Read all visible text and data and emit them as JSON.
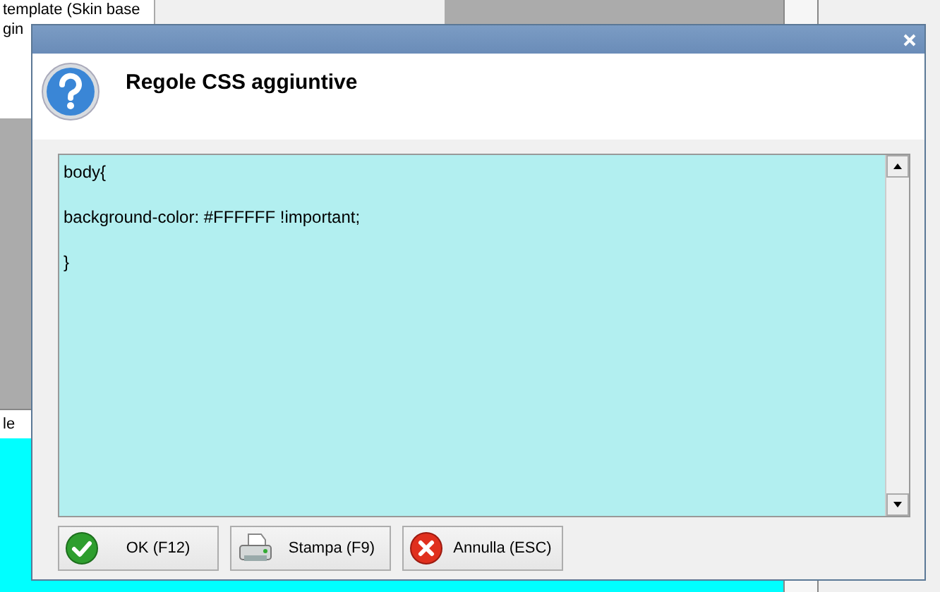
{
  "background": {
    "texts": [
      "template (Skin base",
      "gin",
      "le"
    ]
  },
  "dialog": {
    "title": "Regole CSS aggiuntive",
    "editor": {
      "code": "body{\n\nbackground-color: #FFFFFF !important;\n\n}"
    },
    "buttons": [
      {
        "kind": "ok",
        "label": "OK (F12)"
      },
      {
        "kind": "print",
        "label": "Stampa (F9)"
      },
      {
        "kind": "cancel",
        "label": "Annulla (ESC)"
      }
    ]
  }
}
